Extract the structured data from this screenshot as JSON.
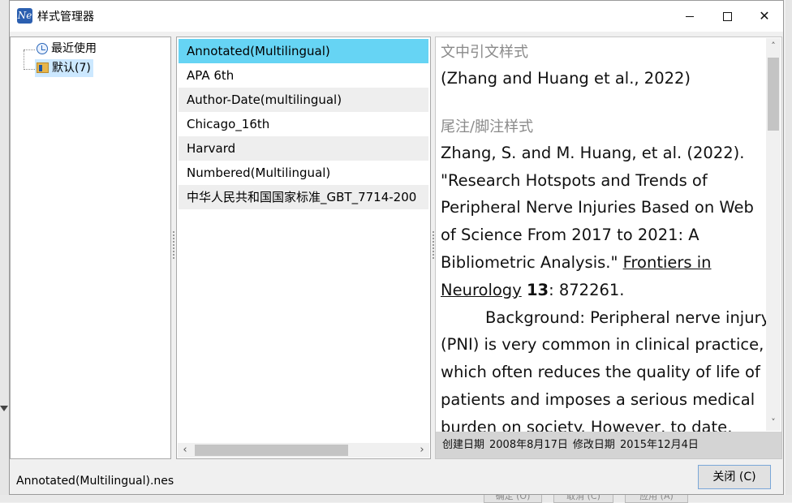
{
  "window": {
    "title": "样式管理器",
    "app_icon_text": "Ne"
  },
  "tree": {
    "items": [
      {
        "label": "最近使用",
        "icon": "clock-icon"
      },
      {
        "label": "默认(7)",
        "icon": "folder-icon",
        "selected": true
      }
    ]
  },
  "styles": {
    "items": [
      {
        "label": "Annotated(Multilingual)",
        "selected": true
      },
      {
        "label": "APA 6th"
      },
      {
        "label": "Author-Date(multilingual)"
      },
      {
        "label": "Chicago_16th"
      },
      {
        "label": "Harvard"
      },
      {
        "label": "Numbered(Multilingual)"
      },
      {
        "label": "中华人民共和国国家标准_GBT_7714-200"
      }
    ]
  },
  "preview": {
    "intext_heading": "文中引文样式",
    "intext_citation": "(Zhang and Huang et al., 2022)",
    "biblio_heading": "尾注/脚注样式",
    "biblio_lines": [
      "Zhang, S. and M. Huang, et al. (2022).",
      "\"Research Hotspots and Trends of",
      "Peripheral Nerve Injuries Based on Web",
      "of Science From 2017 to 2021: A",
      "Bibliometric Analysis.\" "
    ],
    "journal_part1": "Frontiers in",
    "journal_part2": "Neurology",
    "volume": "13",
    "pages": ": 872261.",
    "abstract_lines": [
      "Background: Peripheral nerve injury",
      "(PNI) is very common in clinical practice,",
      "which often reduces the quality of life of",
      "patients and imposes a serious medical",
      "burden on society. However, to date,"
    ],
    "footer": {
      "created_label": "创建日期",
      "created_value": "2008年8月17日",
      "modified_label": "修改日期",
      "modified_value": "2015年12月4日"
    }
  },
  "status": {
    "file_name": "Annotated(Multilingual).nes"
  },
  "buttons": {
    "close": "关闭 (C)"
  },
  "backdrop": {
    "ghost_buttons": [
      "确定 (O)",
      "取消 (C)",
      "应用 (A)"
    ]
  }
}
